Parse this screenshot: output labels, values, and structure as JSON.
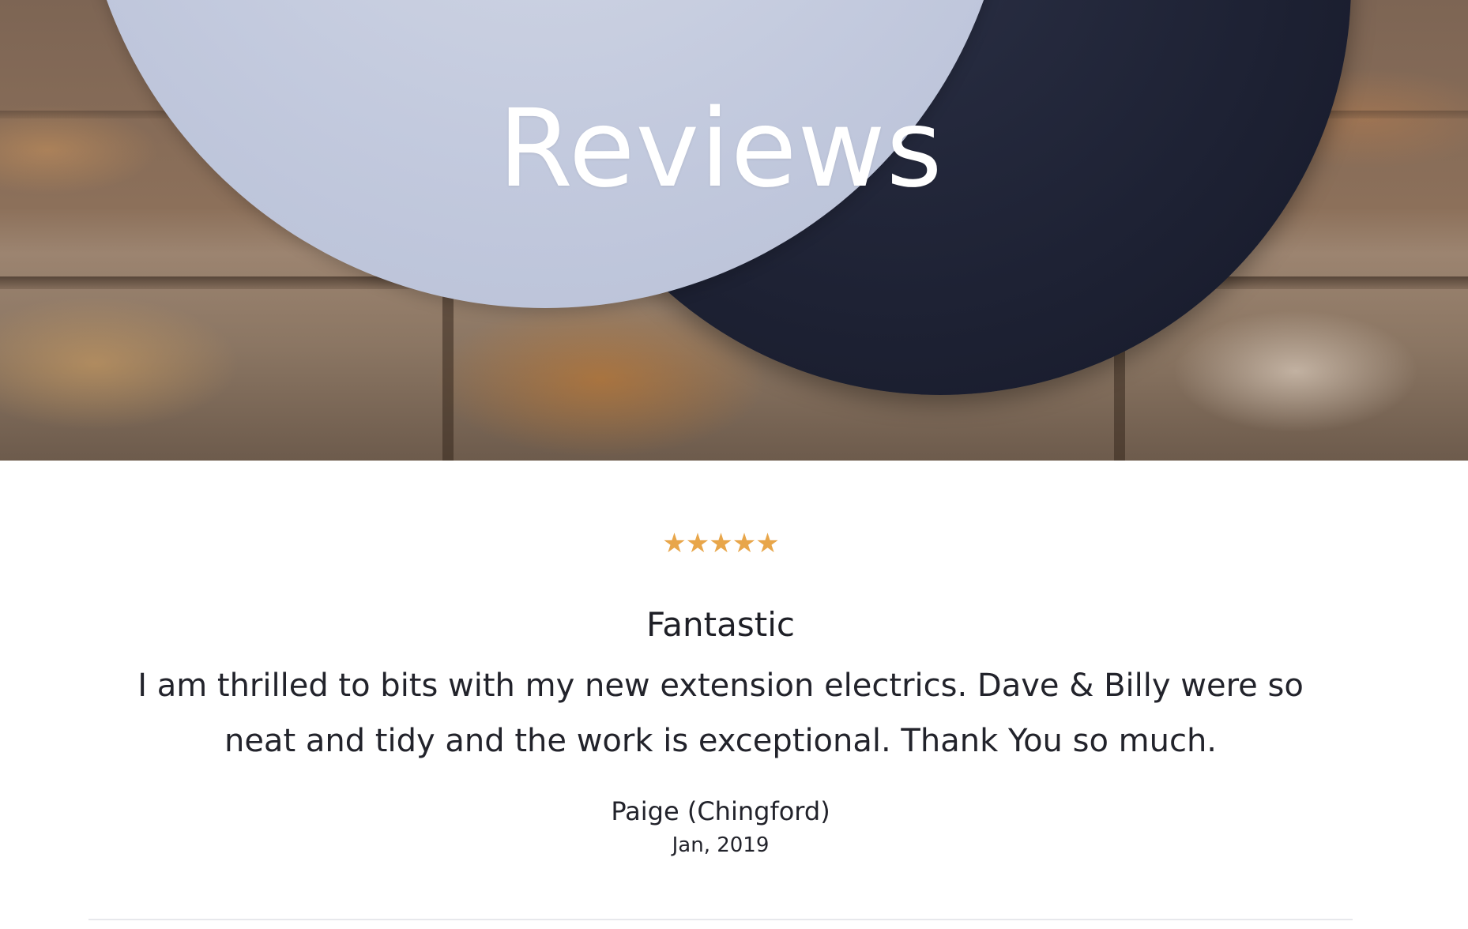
{
  "hero": {
    "title": "Reviews"
  },
  "review": {
    "rating": 5,
    "rating_max": 5,
    "star_color": "#e8a64a",
    "title": "Fantastic",
    "body": "I am thrilled to bits with my new extension electrics. Dave & Billy were so neat and tidy and the work is exceptional. Thank You so much.",
    "author": "Paige (Chingford)",
    "date": "Jan, 2019"
  }
}
